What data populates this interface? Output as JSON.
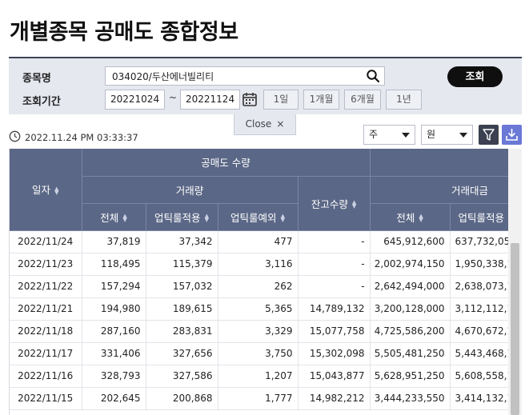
{
  "page": {
    "title": "개별종목 공매도 종합정보"
  },
  "search": {
    "stock_label": "종목명",
    "stock_value": "034020/두산에너빌리티",
    "period_label": "조회기간",
    "date_from": "20221024",
    "date_to": "20221124",
    "tilde": "~",
    "lookup_button": "조회",
    "period_buttons": [
      "1일",
      "1개월",
      "6개월",
      "1년"
    ],
    "close_label": "Close",
    "close_x": "×"
  },
  "toolbar": {
    "timestamp": "2022.11.24 PM 03:33:37",
    "period_select": "주",
    "unit_select": "원"
  },
  "table": {
    "headers": {
      "date": "일자",
      "short_volume_group": "공매도 수량",
      "trade_volume": "거래량",
      "balance_volume": "잔고수량",
      "trade_amount": "거래대금",
      "total": "전체",
      "uptick_applied": "업틱룰적용",
      "uptick_exempt": "업틱룰예외",
      "total_amount": "전체",
      "uptick_applied_amount": "업틱룰적용"
    },
    "rows": [
      {
        "date": "2022/11/24",
        "total": "37,819",
        "uptick": "37,342",
        "exempt": "477",
        "balance": "-",
        "amount_total": "645,912,600",
        "amount_uptick": "637,732,05"
      },
      {
        "date": "2022/11/23",
        "total": "118,495",
        "uptick": "115,379",
        "exempt": "3,116",
        "balance": "-",
        "amount_total": "2,002,974,150",
        "amount_uptick": "1,950,338,1"
      },
      {
        "date": "2022/11/22",
        "total": "157,294",
        "uptick": "157,032",
        "exempt": "262",
        "balance": "-",
        "amount_total": "2,642,494,000",
        "amount_uptick": "2,638,073,1"
      },
      {
        "date": "2022/11/21",
        "total": "194,980",
        "uptick": "189,615",
        "exempt": "5,365",
        "balance": "14,789,132",
        "amount_total": "3,200,128,000",
        "amount_uptick": "3,112,112,1"
      },
      {
        "date": "2022/11/18",
        "total": "287,160",
        "uptick": "283,831",
        "exempt": "3,329",
        "balance": "15,077,758",
        "amount_total": "4,725,586,200",
        "amount_uptick": "4,670,672,1"
      },
      {
        "date": "2022/11/17",
        "total": "331,406",
        "uptick": "327,656",
        "exempt": "3,750",
        "balance": "15,302,098",
        "amount_total": "5,505,481,250",
        "amount_uptick": "5,443,468,1"
      },
      {
        "date": "2022/11/16",
        "total": "328,793",
        "uptick": "327,586",
        "exempt": "1,207",
        "balance": "15,043,877",
        "amount_total": "5,628,951,250",
        "amount_uptick": "5,608,558,1"
      },
      {
        "date": "2022/11/15",
        "total": "202,645",
        "uptick": "200,868",
        "exempt": "1,777",
        "balance": "14,982,212",
        "amount_total": "3,444,233,550",
        "amount_uptick": "3,414,132,1"
      }
    ]
  },
  "colors": {
    "header_bg": "#5b6786",
    "panel_bg": "#e6e8f0",
    "lookup_button_bg": "#0f0f0f",
    "download_button_bg": "#6a78d6",
    "filter_button_bg": "#3b4150"
  },
  "icons": [
    "search-icon",
    "calendar-icon",
    "clock-icon",
    "filter-icon",
    "download-icon",
    "sort-icon"
  ]
}
